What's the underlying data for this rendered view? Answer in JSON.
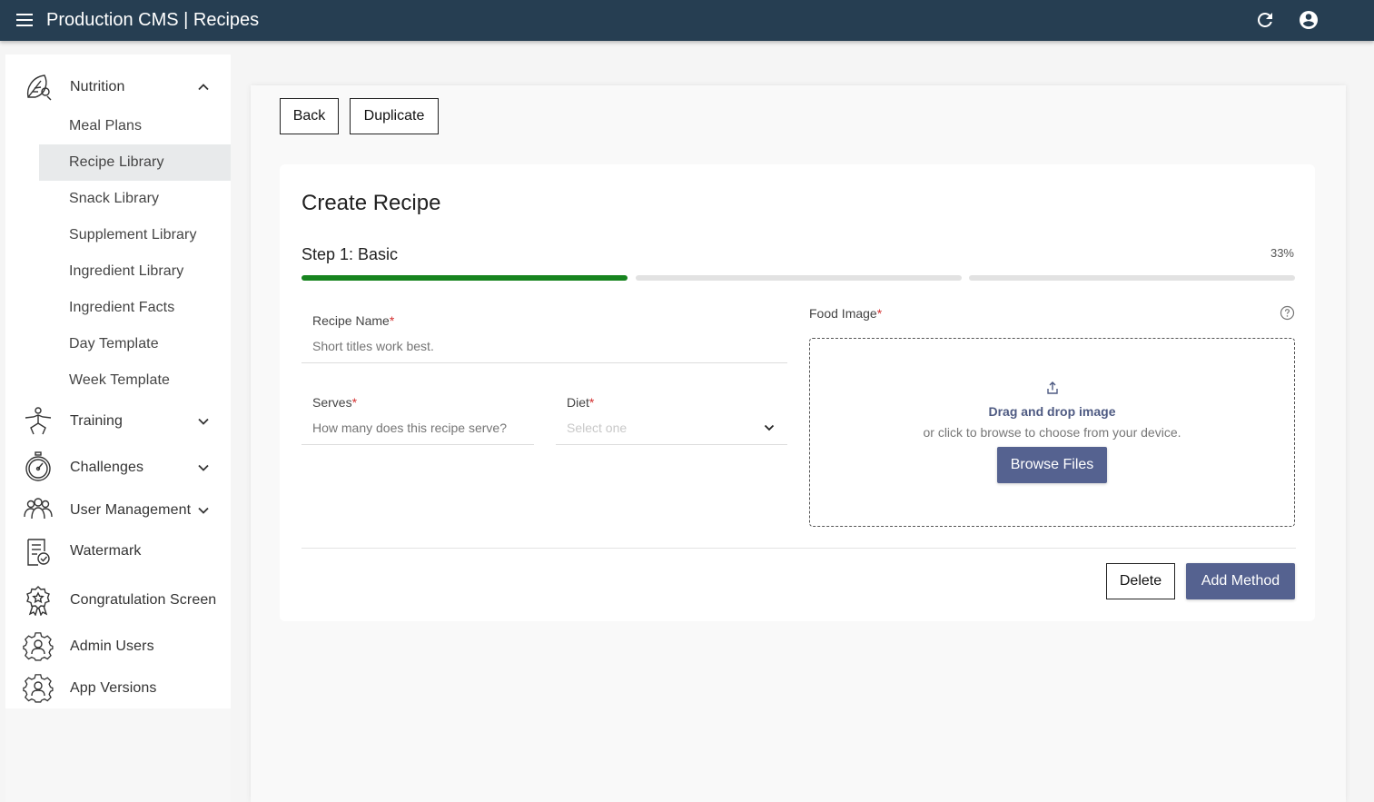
{
  "header": {
    "title": "Production CMS | Recipes"
  },
  "sidebar": {
    "nutrition": {
      "label": "Nutrition",
      "items": [
        {
          "label": "Meal Plans"
        },
        {
          "label": "Recipe Library"
        },
        {
          "label": "Snack Library"
        },
        {
          "label": "Supplement Library"
        },
        {
          "label": "Ingredient Library"
        },
        {
          "label": "Ingredient Facts"
        },
        {
          "label": "Day Template"
        },
        {
          "label": "Week Template"
        }
      ],
      "active_item": "Recipe Library"
    },
    "groups": [
      {
        "label": "Training",
        "icon": "training-icon"
      },
      {
        "label": "Challenges",
        "icon": "stopwatch-icon"
      },
      {
        "label": "User Management",
        "icon": "users-icon"
      },
      {
        "label": "Watermark",
        "icon": "clipboard-check-icon"
      },
      {
        "label": "Congratulation Screen",
        "icon": "award-icon"
      },
      {
        "label": "Admin Users",
        "icon": "gear-user-icon"
      },
      {
        "label": "App Versions",
        "icon": "gear-user-icon"
      }
    ]
  },
  "toolbar": {
    "back_label": "Back",
    "duplicate_label": "Duplicate"
  },
  "form": {
    "title": "Create Recipe",
    "step_title": "Step 1: Basic",
    "progress_percent_text": "33%",
    "progress_fraction": 0.33,
    "recipe_name": {
      "label": "Recipe Name",
      "required_mark": "*",
      "placeholder": "Short titles work best.",
      "value": ""
    },
    "serves": {
      "label": "Serves",
      "required_mark": "*",
      "placeholder": "How many does this recipe serve?",
      "value": ""
    },
    "diet": {
      "label": "Diet",
      "required_mark": "*",
      "placeholder": "Select one"
    },
    "food_image": {
      "label": "Food Image",
      "required_mark": "*",
      "drop_title": "Drag and drop image",
      "drop_subtitle": "or click to browse to choose from your device.",
      "browse_label": "Browse Files"
    },
    "delete_label": "Delete",
    "add_method_label": "Add Method"
  },
  "colors": {
    "topbar": "#263e52",
    "accent": "#556290",
    "progress_done": "#17841f",
    "required": "#d32f2f"
  }
}
